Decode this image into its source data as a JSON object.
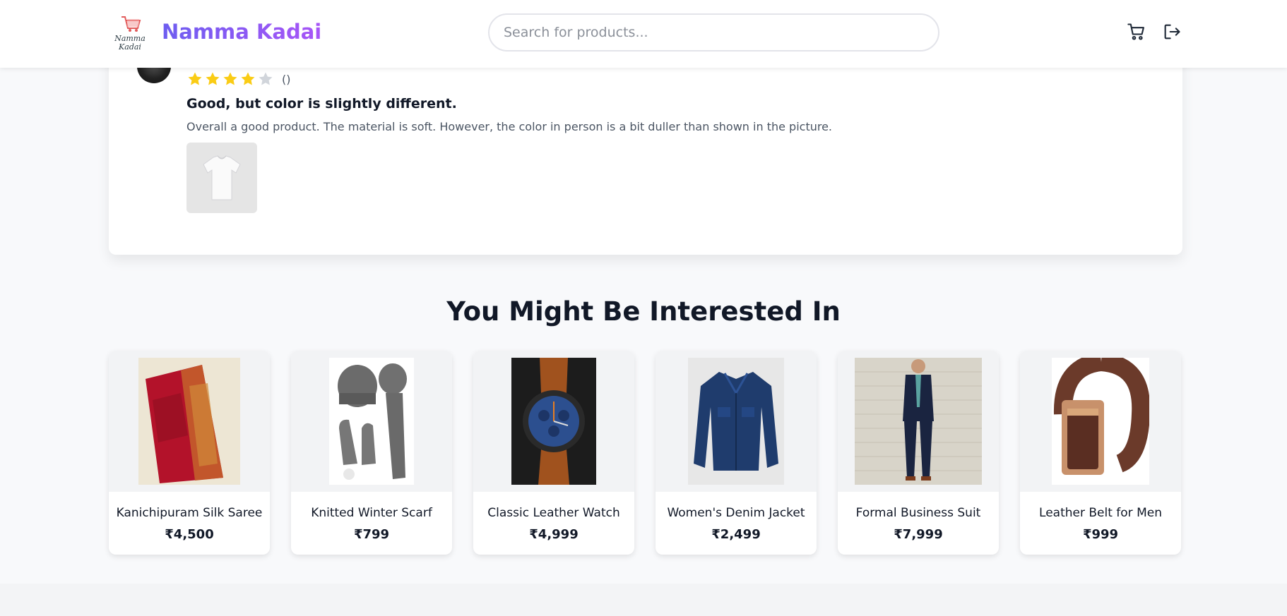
{
  "header": {
    "brand": "Namma Kadai",
    "logo_text_line1": "Namma",
    "logo_text_line2": "Kadai",
    "search_placeholder": "Search for products...",
    "brand_gradient": [
      "#6d5df0",
      "#a855f7"
    ],
    "icons": [
      "shopping-cart-icon",
      "logout-icon"
    ]
  },
  "review": {
    "rating": 4,
    "max_rating": 5,
    "rating_count": "()",
    "title": "Good, but color is slightly different.",
    "body": "Overall a good product. The material is soft. However, the color in person is a bit duller than shown in the picture.",
    "image": "white-tshirt"
  },
  "recommendations": {
    "title": "You Might Be Interested In",
    "products": [
      {
        "name": "Kanichipuram Silk Saree",
        "price": "₹4,500",
        "image": "silk-saree"
      },
      {
        "name": "Knitted Winter Scarf",
        "price": "₹799",
        "image": "winter-scarf-set"
      },
      {
        "name": "Classic Leather Watch",
        "price": "₹4,999",
        "image": "leather-watch"
      },
      {
        "name": "Women's Denim Jacket",
        "price": "₹2,499",
        "image": "denim-jacket"
      },
      {
        "name": "Formal Business Suit",
        "price": "₹7,999",
        "image": "business-suit"
      },
      {
        "name": "Leather Belt for Men",
        "price": "₹999",
        "image": "leather-belt"
      }
    ]
  },
  "colors": {
    "star_filled": "#facc15",
    "star_empty": "#d1d5db",
    "page_bg": "#f8f9fb"
  }
}
